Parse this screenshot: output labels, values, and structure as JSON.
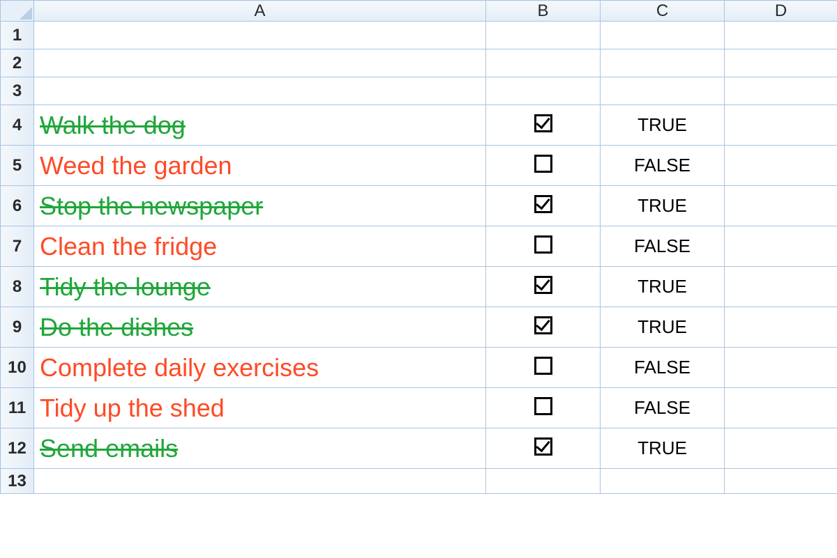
{
  "columns": [
    "A",
    "B",
    "C",
    "D"
  ],
  "rowNumbers": [
    1,
    2,
    3,
    4,
    5,
    6,
    7,
    8,
    9,
    10,
    11,
    12,
    13
  ],
  "trueLabel": "TRUE",
  "falseLabel": "FALSE",
  "tasks": [
    {
      "row": 4,
      "text": "Walk the dog",
      "checked": true
    },
    {
      "row": 5,
      "text": "Weed the garden",
      "checked": false
    },
    {
      "row": 6,
      "text": "Stop the newspaper",
      "checked": true
    },
    {
      "row": 7,
      "text": "Clean the fridge",
      "checked": false
    },
    {
      "row": 8,
      "text": "Tidy the lounge",
      "checked": true
    },
    {
      "row": 9,
      "text": "Do the dishes",
      "checked": true
    },
    {
      "row": 10,
      "text": "Complete daily exercises",
      "checked": false
    },
    {
      "row": 11,
      "text": "Tidy up the shed",
      "checked": false
    },
    {
      "row": 12,
      "text": "Send emails",
      "checked": true
    }
  ]
}
